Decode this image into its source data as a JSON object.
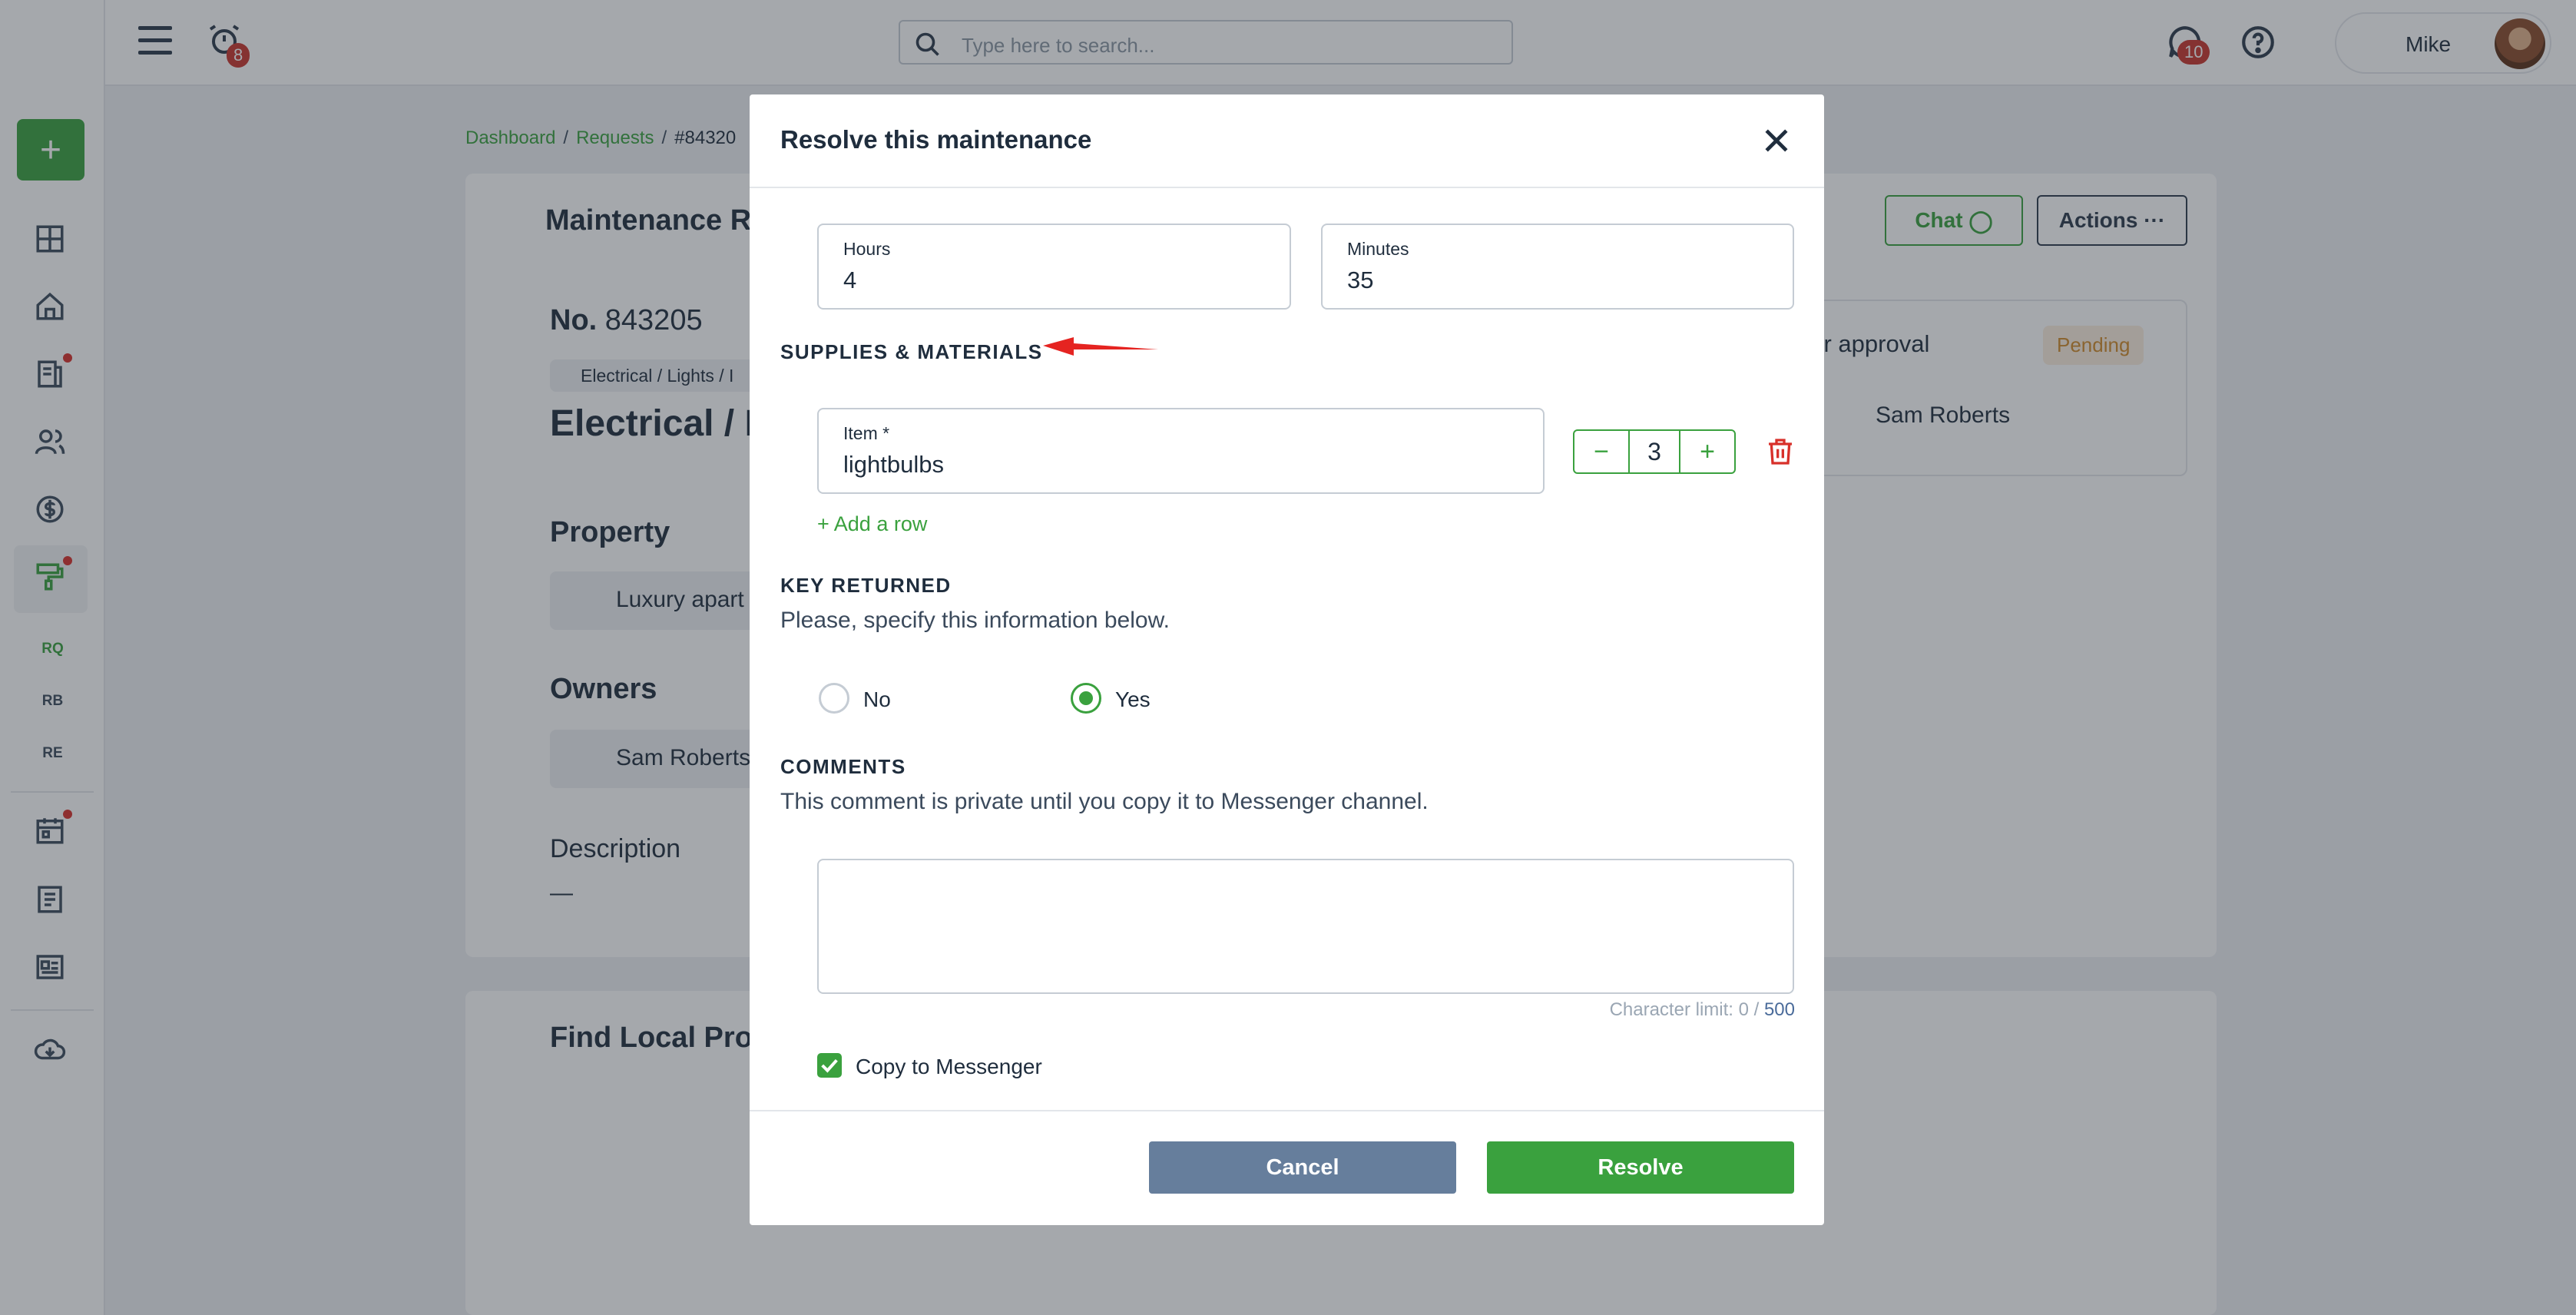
{
  "topbar": {
    "notifications_count": "8",
    "search_placeholder": "Type here to search...",
    "messages_count": "10",
    "user_name": "Mike"
  },
  "sidebar": {
    "items": [
      "RQ",
      "RB",
      "RE"
    ]
  },
  "background": {
    "breadcrumb": [
      "Dashboard",
      "Requests",
      "#84320"
    ],
    "page_title": "Maintenance R",
    "request_no_label": "No.",
    "request_no": "843205",
    "category_chip": "Electrical / Lights / I",
    "category_title": "Electrical / L",
    "property_heading": "Property",
    "property_value": "Luxury apart",
    "owners_heading": "Owners",
    "owner_name": "Sam Roberts",
    "description_heading": "Description",
    "description_value": "—",
    "chat_button": "Chat",
    "actions_button": "Actions",
    "approval_heading": "ner approval",
    "approval_status": "Pending",
    "approver_name": "Sam Roberts",
    "find_local_heading": "Find Local Prof"
  },
  "modal": {
    "title": "Resolve this maintenance",
    "hours_label": "Hours",
    "hours_value": "4",
    "minutes_label": "Minutes",
    "minutes_value": "35",
    "supplies_heading": "SUPPLIES & MATERIALS",
    "item_label": "Item *",
    "item_value": "lightbulbs",
    "item_quantity": "3",
    "add_row_label": "+ Add a row",
    "key_heading": "KEY RETURNED",
    "key_sub": "Please, specify this information below.",
    "key_options": [
      "No",
      "Yes"
    ],
    "key_selected": "Yes",
    "comments_heading": "COMMENTS",
    "comments_sub": "This comment is private until you copy it to Messenger channel.",
    "comment_value": "",
    "char_limit_label": "Character limit: 0 /",
    "char_limit_max": "500",
    "copy_label": "Copy to Messenger",
    "copy_checked": true,
    "cancel_label": "Cancel",
    "resolve_label": "Resolve"
  },
  "colors": {
    "accent": "#3aa13e",
    "danger": "#d8302a",
    "cancel": "#667e9c"
  }
}
